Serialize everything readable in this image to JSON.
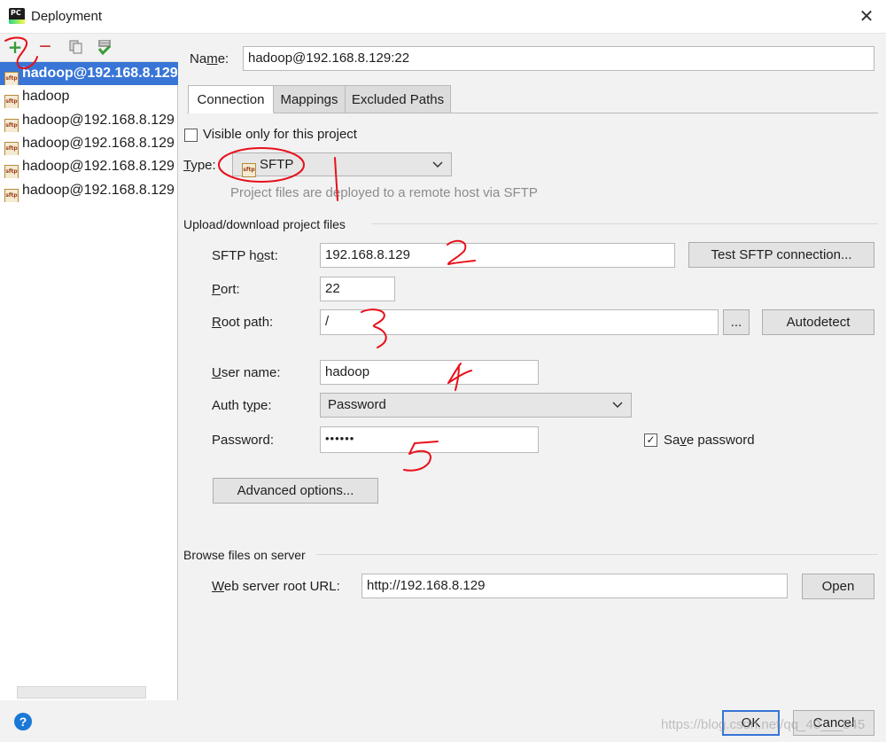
{
  "window": {
    "title": "Deployment",
    "close": "✕"
  },
  "toolbar": {
    "add_icon": "+",
    "remove_icon": "—"
  },
  "servers": [
    {
      "label": "hadoop@192.168.8.129",
      "selected": true
    },
    {
      "label": "hadoop",
      "selected": false
    },
    {
      "label": "hadoop@192.168.8.129",
      "selected": false
    },
    {
      "label": "hadoop@192.168.8.129",
      "selected": false
    },
    {
      "label": "hadoop@192.168.8.129",
      "selected": false
    },
    {
      "label": "hadoop@192.168.8.129",
      "selected": false
    }
  ],
  "server_icon_text": "sftp",
  "name": {
    "label_pre": "Na",
    "label_u": "m",
    "label_post": "e:",
    "value": "hadoop@192.168.8.129:22"
  },
  "tabs": [
    "Connection",
    "Mappings",
    "Excluded Paths"
  ],
  "connection": {
    "visible_only": "Visible only for this project",
    "visible_only_checked": false,
    "type_label_u": "T",
    "type_label_post": "ype:",
    "type_value": "SFTP",
    "type_hint": "Project files are deployed to a remote host via SFTP",
    "upload_section": "Upload/download project files",
    "host_label_pre": "SFTP h",
    "host_label_u": "o",
    "host_label_post": "st:",
    "host_value": "192.168.8.129",
    "test_button": "Test SFTP connection...",
    "port_label_u": "P",
    "port_label_post": "ort:",
    "port_value": "22",
    "root_label_u": "R",
    "root_label_post": "oot path:",
    "root_value": "/",
    "browse_button": "...",
    "autodetect_button": "Autodetect",
    "user_label_u": "U",
    "user_label_post": "ser name:",
    "user_value": "hadoop",
    "auth_label_pre": "Auth t",
    "auth_label_u": "y",
    "auth_label_post": "pe:",
    "auth_value": "Password",
    "password_label": "Password:",
    "password_value": "••••••",
    "save_password_pre": "Sa",
    "save_password_u": "v",
    "save_password_post": "e password",
    "save_password_checked": true,
    "advanced_button": "Advanced options...",
    "browse_section": "Browse files on server",
    "web_label_u": "W",
    "web_label_post": "eb server root URL:",
    "web_value": "http://192.168.8.129",
    "open_button": "Open"
  },
  "footer": {
    "help": "?",
    "ok": "OK",
    "cancel": "Cancel",
    "watermark": "https://blog.csdn.net/qq_40___545"
  },
  "colors": {
    "selection": "#3875d7",
    "annotation": "#e8101a",
    "help": "#1a78d6"
  }
}
